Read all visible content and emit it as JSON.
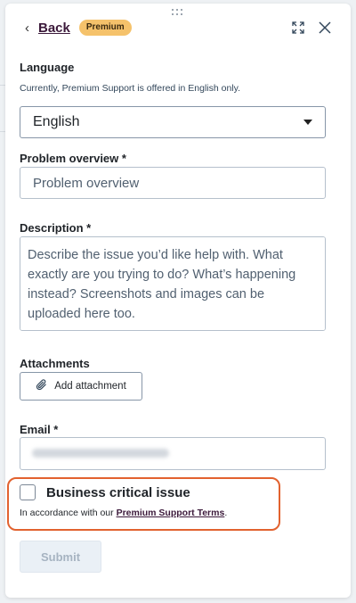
{
  "header": {
    "back_label": "Back",
    "badge_label": "Premium"
  },
  "language": {
    "label": "Language",
    "help": "Currently, Premium Support is offered in English only.",
    "selected": "English"
  },
  "problem_overview": {
    "label": "Problem overview *",
    "placeholder": "Problem overview"
  },
  "description": {
    "label": "Description *",
    "placeholder": "Describe the issue you’d like help with. What exactly are you trying to do? What’s happening instead? Screenshots and images can be uploaded here too."
  },
  "attachments": {
    "label": "Attachments",
    "button_label": "Add attachment"
  },
  "email": {
    "label": "Email *"
  },
  "business_critical": {
    "label": "Business critical issue",
    "checked": false,
    "terms_prefix": "In accordance with our ",
    "terms_link": "Premium Support Terms",
    "terms_suffix": "."
  },
  "submit_label": "Submit",
  "colors": {
    "badge": "#f5c26b",
    "link": "#3c1a3b",
    "highlight_border": "#e2622f",
    "disabled_button": "#eaf0f6"
  },
  "icons": [
    "drag-handle-icon",
    "chevron-left-icon",
    "expand-icon",
    "close-icon",
    "paperclip-icon",
    "caret-down-icon"
  ]
}
